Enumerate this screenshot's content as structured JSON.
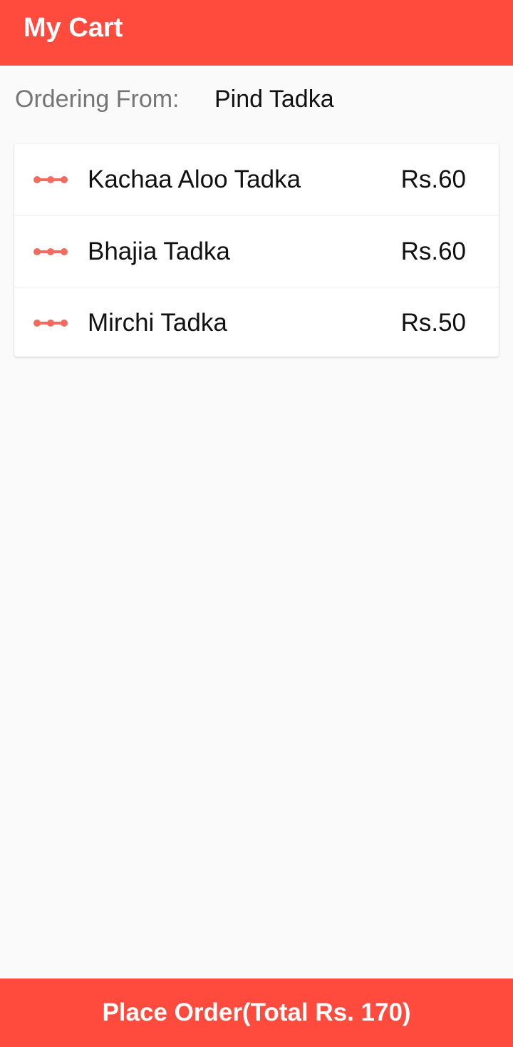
{
  "appbar": {
    "title": "My Cart",
    "background_color": "#ff4b3e"
  },
  "ordering": {
    "label": "Ordering From:",
    "restaurant": "Pind Tadka"
  },
  "cart": {
    "icon": "dumbbell-icon",
    "icon_color": "#f26b5e",
    "items": [
      {
        "name": "Kachaa Aloo Tadka",
        "price": "Rs.60"
      },
      {
        "name": "Bhajia Tadka",
        "price": "Rs.60"
      },
      {
        "name": "Mirchi Tadka",
        "price": "Rs.50"
      }
    ]
  },
  "footer": {
    "place_order_label": "Place Order(Total Rs. 170)",
    "background_color": "#ff4b3e"
  }
}
